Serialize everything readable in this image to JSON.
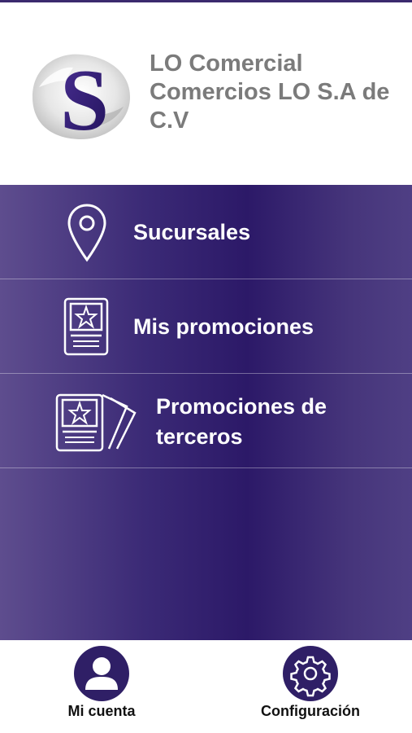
{
  "header": {
    "logo_letter": "S",
    "company_lines": [
      "LO Comercial",
      "Comercios LO S.A de",
      "C.V"
    ]
  },
  "menu": {
    "items": [
      {
        "label": "Sucursales",
        "icon": "location-pin-icon"
      },
      {
        "label": "Mis promociones",
        "icon": "promotion-card-icon"
      },
      {
        "label_lines": [
          "Promociones de",
          "terceros"
        ],
        "icon": "promotion-cards-stack-icon"
      }
    ]
  },
  "bottom_nav": {
    "account_label": "Mi cuenta",
    "account_icon": "user-icon",
    "settings_label": "Configuración",
    "settings_icon": "gear-icon"
  },
  "colors": {
    "brand_purple": "#2f1f66",
    "company_text": "#7b7b7b"
  }
}
